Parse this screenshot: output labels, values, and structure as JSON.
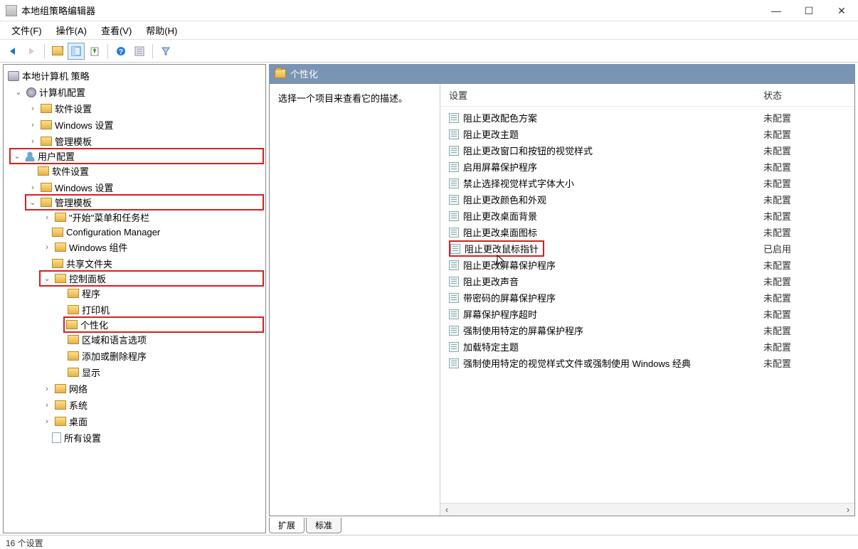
{
  "window": {
    "title": "本地组策略编辑器"
  },
  "menu": {
    "file": "文件(F)",
    "action": "操作(A)",
    "view": "查看(V)",
    "help": "帮助(H)"
  },
  "tree": {
    "root": "本地计算机 策略",
    "computer_config": "计算机配置",
    "cc_software": "软件设置",
    "cc_windows": "Windows 设置",
    "cc_admin": "管理模板",
    "user_config": "用户配置",
    "uc_software": "软件设置",
    "uc_windows": "Windows 设置",
    "uc_admin": "管理模板",
    "start_menu": "\"开始\"菜单和任务栏",
    "config_mgr": "Configuration Manager",
    "win_components": "Windows 组件",
    "shared_folders": "共享文件夹",
    "control_panel": "控制面板",
    "programs": "程序",
    "printers": "打印机",
    "personalization": "个性化",
    "region_lang": "区域和语言选项",
    "add_remove": "添加或删除程序",
    "display": "显示",
    "network": "网络",
    "system": "系统",
    "desktop": "桌面",
    "all_settings": "所有设置"
  },
  "header": {
    "title": "个性化"
  },
  "desc": {
    "text": "选择一个项目来查看它的描述。"
  },
  "columns": {
    "setting": "设置",
    "state": "状态"
  },
  "state": {
    "not_configured": "未配置",
    "enabled": "已启用"
  },
  "settings": [
    {
      "name": "阻止更改配色方案",
      "state": "未配置"
    },
    {
      "name": "阻止更改主题",
      "state": "未配置"
    },
    {
      "name": "阻止更改窗口和按钮的视觉样式",
      "state": "未配置"
    },
    {
      "name": "启用屏幕保护程序",
      "state": "未配置"
    },
    {
      "name": "禁止选择视觉样式字体大小",
      "state": "未配置"
    },
    {
      "name": "阻止更改颜色和外观",
      "state": "未配置"
    },
    {
      "name": "阻止更改桌面背景",
      "state": "未配置"
    },
    {
      "name": "阻止更改桌面图标",
      "state": "未配置"
    },
    {
      "name": "阻止更改鼠标指针",
      "state": "已启用"
    },
    {
      "name": "阻止更改屏幕保护程序",
      "state": "未配置"
    },
    {
      "name": "阻止更改声音",
      "state": "未配置"
    },
    {
      "name": "带密码的屏幕保护程序",
      "state": "未配置"
    },
    {
      "name": "屏幕保护程序超时",
      "state": "未配置"
    },
    {
      "name": "强制使用特定的屏幕保护程序",
      "state": "未配置"
    },
    {
      "name": "加载特定主题",
      "state": "未配置"
    },
    {
      "name": "强制使用特定的视觉样式文件或强制使用 Windows 经典",
      "state": "未配置"
    }
  ],
  "tabs": {
    "extended": "扩展",
    "standard": "标准"
  },
  "status": {
    "count": "16 个设置"
  }
}
